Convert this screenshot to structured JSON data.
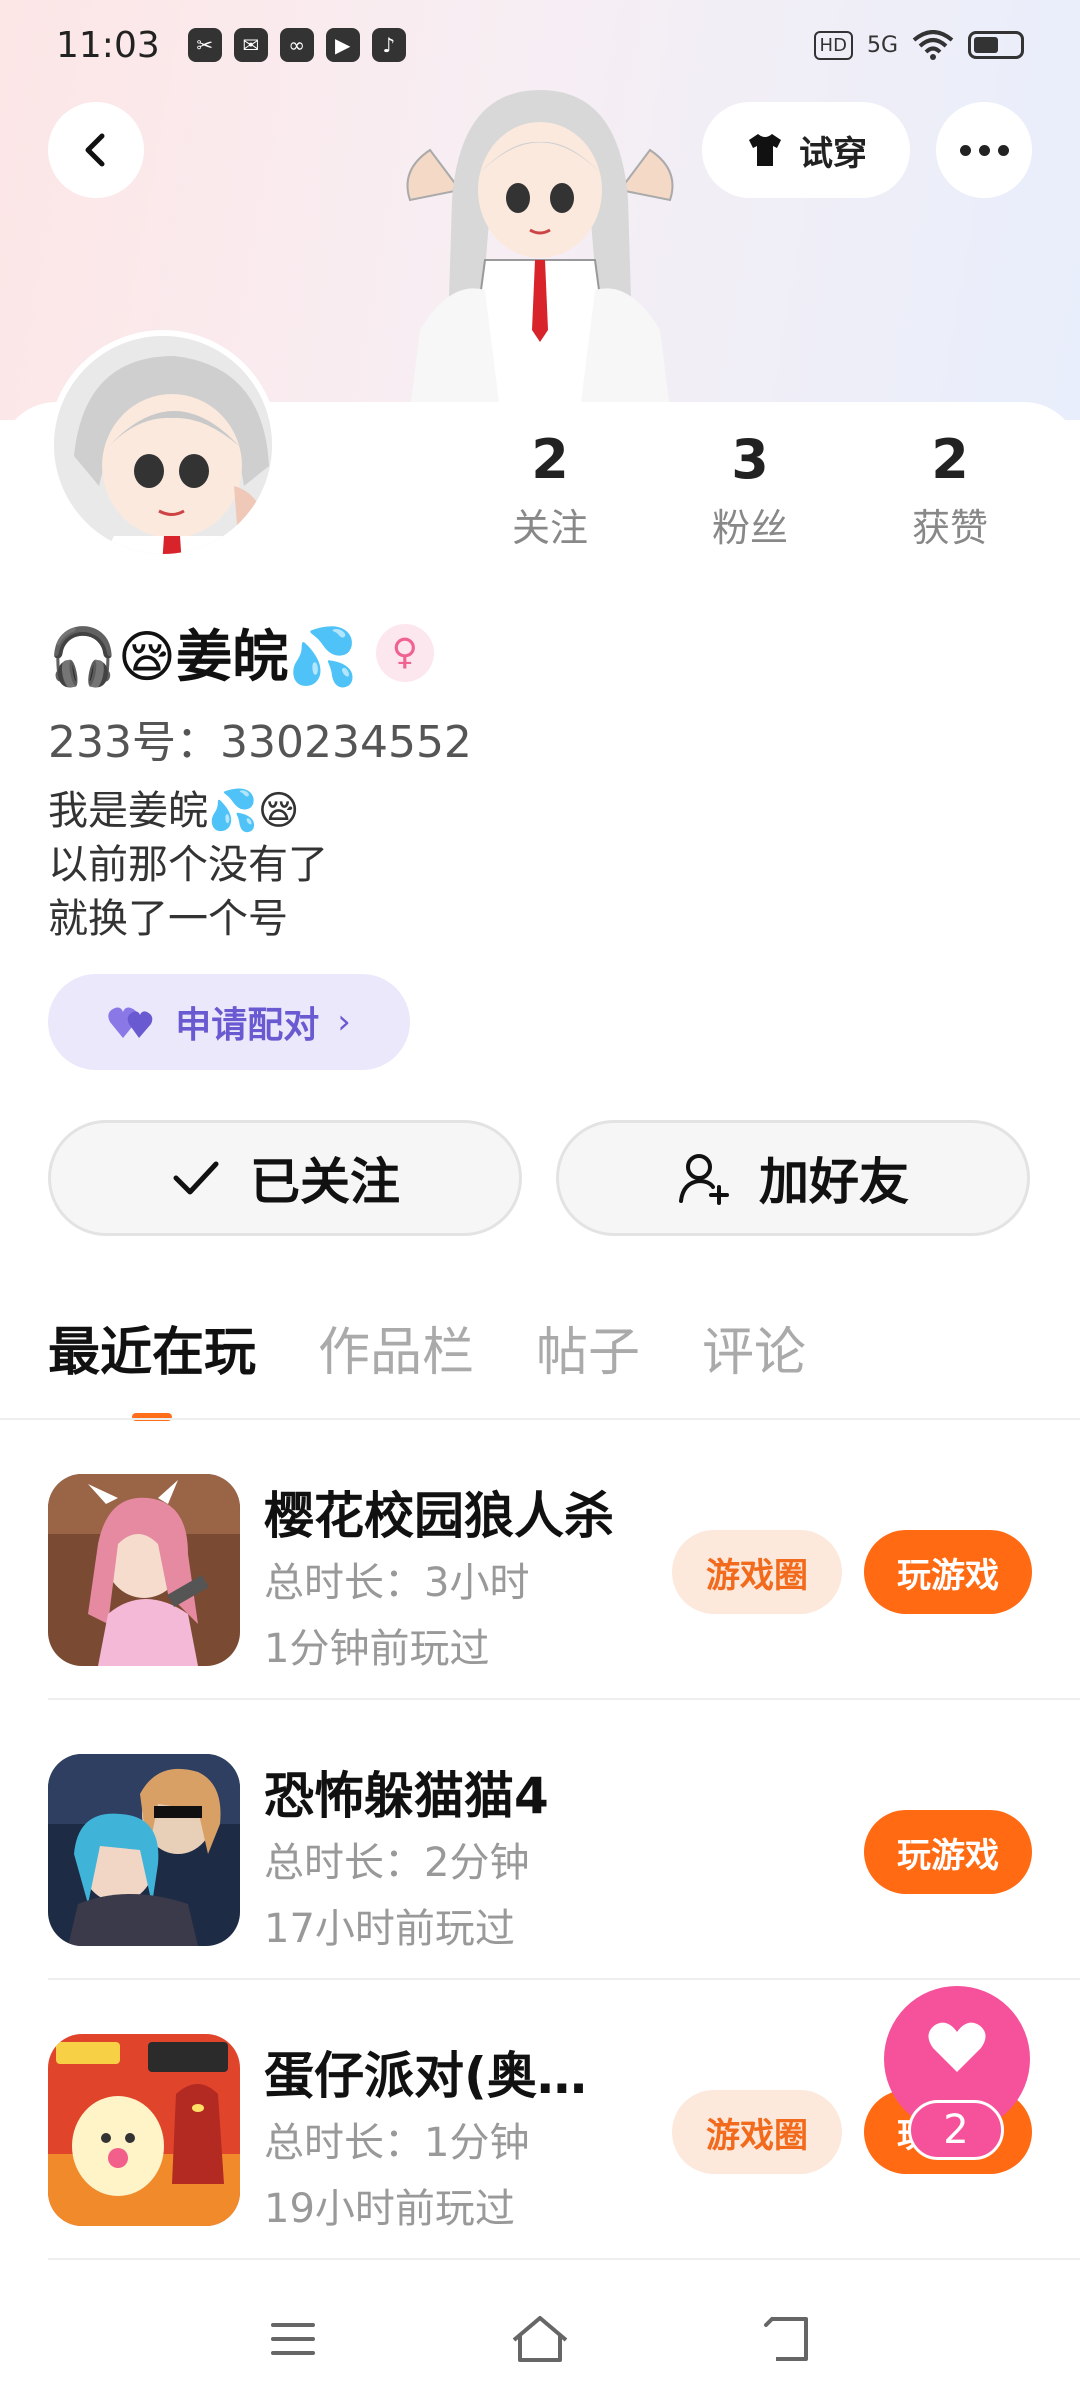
{
  "status_bar": {
    "time": "11:03",
    "notification_icons": [
      "app-icon-1",
      "mail-icon",
      "link-icon",
      "play-icon",
      "tiktok-icon"
    ],
    "hd_label": "HD",
    "network_label": "5G"
  },
  "header": {
    "tryon_label": "试穿"
  },
  "stats": [
    {
      "value": "2",
      "label": "关注"
    },
    {
      "value": "3",
      "label": "粉丝"
    },
    {
      "value": "2",
      "label": "获赞"
    }
  ],
  "profile": {
    "name": "🎧😪姜皖💦",
    "gender_symbol": "♀",
    "uid": "233号：330234552",
    "bio_lines": [
      "我是姜皖💦😪",
      "以前那个没有了",
      "就换了一个号"
    ]
  },
  "pair_button": {
    "label": "申请配对"
  },
  "actions": {
    "followed_label": "已关注",
    "add_friend_label": "加好友"
  },
  "tabs": [
    {
      "label": "最近在玩",
      "active": true
    },
    {
      "label": "作品栏",
      "active": false
    },
    {
      "label": "帖子",
      "active": false
    },
    {
      "label": "评论",
      "active": false
    }
  ],
  "games": [
    {
      "title": "樱花校园狼人杀",
      "duration": "总时长：3小时",
      "last_played": "1分钟前玩过",
      "circle_label": "游戏圈",
      "play_label": "玩游戏",
      "has_circle": true
    },
    {
      "title": "恐怖躲猫猫4",
      "duration": "总时长：2分钟",
      "last_played": "17小时前玩过",
      "circle_label": "",
      "play_label": "玩游戏",
      "has_circle": false
    },
    {
      "title": "蛋仔派对(奥…",
      "duration": "总时长：1分钟",
      "last_played": "19小时前玩过",
      "circle_label": "游戏圈",
      "play_label": "玩游戏",
      "has_circle": true
    }
  ],
  "like_fab": {
    "count": "2"
  },
  "colors": {
    "accent": "#ff6a12",
    "pair": "#6a5ad1",
    "like": "#f6519b"
  }
}
